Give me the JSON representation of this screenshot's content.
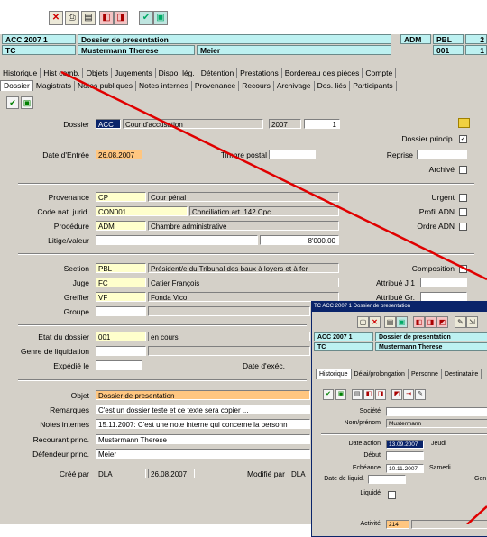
{
  "header": {
    "row1": {
      "code": "ACC 2007 1",
      "title": "Dossier de presentation",
      "c3": "ADM",
      "c4": "PBL",
      "c5": "2"
    },
    "row2": {
      "code": "TC",
      "name": "Mustermann Therese",
      "name2": "Meier",
      "c4": "001",
      "c5": "1"
    }
  },
  "tabs_row1": [
    "Historique",
    "Hist comb.",
    "Objets",
    "Jugements",
    "Dispo. lég.",
    "Détention",
    "Prestations",
    "Bordereau des pièces",
    "Compte"
  ],
  "tabs_row2": [
    "Dossier",
    "Magistrats",
    "Notes publiques",
    "Notes internes",
    "Provenance",
    "Recours",
    "Archivage",
    "Dos. liés",
    "Participants"
  ],
  "form": {
    "dossier_label": "Dossier",
    "dossier_code": "ACC",
    "dossier_type": "Cour d'accusation",
    "dossier_year": "2007",
    "dossier_no": "1",
    "dossier_princip_label": "Dossier princip.",
    "date_entree_label": "Date d'Entrée",
    "date_entree": "26.08.2007",
    "timbre_label": "Timbre postal",
    "reprise_label": "Reprise",
    "archive_label": "Archivé",
    "provenance_label": "Provenance",
    "provenance_code": "CP",
    "provenance_text": "Cour pénal",
    "urgent_label": "Urgent",
    "code_nat_label": "Code nat. jurid.",
    "code_nat": "CON001",
    "code_nat_text": "Conciliation art. 142 Cpc",
    "profil_label": "Profil ADN",
    "procedure_label": "Procédure",
    "procedure_code": "ADM",
    "procedure_text": "Chambre administrative",
    "ordre_label": "Ordre ADN",
    "litige_label": "Litige/valeur",
    "litige_value": "8'000.00",
    "section_label": "Section",
    "section_code": "PBL",
    "section_text": "Président/e du Tribunal des baux à loyers et à fer",
    "composition_label": "Composition",
    "juge_label": "Juge",
    "juge_code": "FC",
    "juge_text": "Catier François",
    "attribue_j1_label": "Attribué J 1",
    "greffier_label": "Greffier",
    "greffier_code": "VF",
    "greffier_text": "Fonda Vico",
    "attribue_gr_label": "Attribué Gr.",
    "groupe_label": "Groupe",
    "etat_label": "Etat du dossier",
    "etat_code": "001",
    "etat_text": "en cours",
    "genre_liq_label": "Genre de liquidation",
    "expedie_label": "Expédié le",
    "date_exec_label": "Date d'exéc.",
    "objet_label": "Objet",
    "objet_value": "Dossier de presentation",
    "remarques_label": "Remarques",
    "remarques_value": "C'est un dossier teste et ce texte sera copier ...",
    "notes_label": "Notes internes",
    "notes_value": "15.11.2007: C'est une note interne qui concerne la personn",
    "recourant_label": "Recourant princ.",
    "recourant_value": "Mustermann Therese",
    "defendeur_label": "Défendeur princ.",
    "defendeur_value": "Meier",
    "cree_label": "Créé par",
    "cree_user": "DLA",
    "cree_date": "26.08.2007",
    "modifie_label": "Modifié par",
    "modifie_user": "DLA"
  },
  "dialog": {
    "title": "TC ACC 2007 1 Dossier de presentation",
    "row1_code": "ACC 2007 1",
    "row1_title": "Dossier de presentation",
    "row2_code": "TC",
    "row2_name": "Mustermann Therese",
    "tabs": [
      "Historique",
      "Délai/prolongation",
      "Personne",
      "Destinataire"
    ],
    "societe_label": "Société",
    "nom_label": "Nom/prénom",
    "nom_value": "Mustermann",
    "date_action_label": "Date action",
    "date_action": "13.09.2007",
    "date_action_day": "Jeudi",
    "debut_label": "Début",
    "echeance_label": "Echéance",
    "echeance_value": "10.11.2007",
    "echeance_day": "Samedi",
    "date_liquid_label": "Date de liquid.",
    "gen_label": "Gen",
    "liquide_label": "Liquidé",
    "activite_label": "Activité",
    "activite_code": "214"
  },
  "colors": {
    "accent_line": "#e00000",
    "header_cell": "#bdf1f1",
    "required": "#ffffcc",
    "highlight": "#ffc680"
  }
}
